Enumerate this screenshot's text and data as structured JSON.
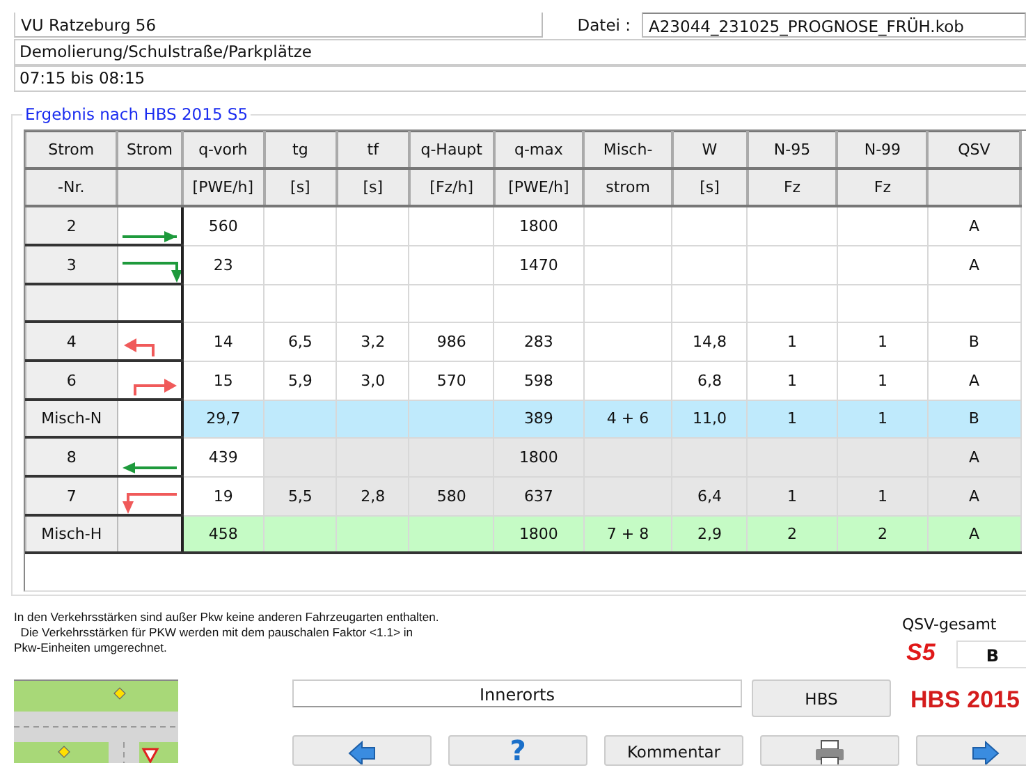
{
  "header": {
    "project": "VU Ratzeburg 56",
    "file_label": "Datei :",
    "file": "A23044_231025_PROGNOSE_FRÜH.kob",
    "location": "Demolierung/Schulstraße/Parkplätze",
    "period": "07:15 bis 08:15"
  },
  "result": {
    "title": "Ergebnis nach  HBS 2015 S5",
    "columns": [
      {
        "line1": "Strom",
        "line2": "-Nr."
      },
      {
        "line1": "Strom"
      },
      {
        "line1": "q-vorh",
        "line2": "[PWE/h]"
      },
      {
        "line1": "tg",
        "line2": "[s]"
      },
      {
        "line1": "tf",
        "line2": "[s]"
      },
      {
        "line1": "q-Haupt",
        "line2": "[Fz/h]"
      },
      {
        "line1": "q-max",
        "line2": "[PWE/h]"
      },
      {
        "line1": "Misch-",
        "line2": "strom"
      },
      {
        "line1": "W",
        "line2": "[s]"
      },
      {
        "line1": "N-95",
        "line2": "Fz"
      },
      {
        "line1": "N-99",
        "line2": "Fz"
      },
      {
        "line1": "QSV"
      }
    ],
    "rows": [
      {
        "kind": "plain",
        "strom_nr": "2",
        "arrow": {
          "kind": "east",
          "color": "#1e9a3c"
        },
        "cells": [
          "560",
          null,
          null,
          null,
          "1800",
          null,
          null,
          null,
          null,
          "A"
        ]
      },
      {
        "kind": "plain",
        "strom_nr": "3",
        "arrow": {
          "kind": "east-south",
          "color": "#1e9a3c"
        },
        "cells": [
          "23",
          null,
          null,
          null,
          "1470",
          null,
          null,
          null,
          null,
          "A"
        ]
      },
      {
        "kind": "plain"
      },
      {
        "kind": "plain",
        "strom_nr": "4",
        "arrow": {
          "kind": "north-west",
          "color": "#f05a5a"
        },
        "cells": [
          "14",
          "6,5",
          "3,2",
          "986",
          "283",
          null,
          "14,8",
          "1",
          "1",
          "B"
        ]
      },
      {
        "kind": "plain",
        "strom_nr": "6",
        "arrow": {
          "kind": "north-east",
          "color": "#f05a5a"
        },
        "cells": [
          "15",
          "5,9",
          "3,0",
          "570",
          "598",
          null,
          "6,8",
          "1",
          "1",
          "A"
        ]
      },
      {
        "kind": "mix-minor",
        "strom_nr": "Misch-N",
        "cells": [
          "29,7",
          null,
          null,
          null,
          "389",
          "4 + 6",
          "11,0",
          "1",
          "1",
          "B"
        ]
      },
      {
        "kind": "major",
        "strom_nr": "8",
        "arrow": {
          "kind": "west",
          "color": "#1e9a3c"
        },
        "cells": [
          "439",
          null,
          null,
          null,
          "1800",
          null,
          null,
          null,
          null,
          "A"
        ]
      },
      {
        "kind": "major",
        "strom_nr": "7",
        "arrow": {
          "kind": "west-south",
          "color": "#f05a5a"
        },
        "cells": [
          "19",
          "5,5",
          "2,8",
          "580",
          "637",
          null,
          "6,4",
          "1",
          "1",
          "A"
        ]
      },
      {
        "kind": "mix-major",
        "strom_nr": "Misch-H",
        "cells": [
          "458",
          null,
          null,
          null,
          "1800",
          "7 + 8",
          "2,9",
          "2",
          "2",
          "A"
        ]
      }
    ]
  },
  "notes": [
    "In den Verkehrsstärken sind außer Pkw keine anderen Fahrzeugarten enthalten.",
    "  Die Verkehrsstärken für PKW werden mit dem pauschalen Faktor <1.1> in",
    "Pkw-Einheiten umgerechnet."
  ],
  "total": {
    "label": "QSV-gesamt",
    "stage": "S5",
    "value": "B"
  },
  "area": "Innerorts",
  "method_button": "HBS",
  "method_logo": "HBS 2015",
  "buttons": [
    {
      "kind": "back"
    },
    {
      "kind": "help",
      "label": "?"
    },
    {
      "kind": "text",
      "label": "Kommentar"
    },
    {
      "kind": "print"
    },
    {
      "kind": "forward"
    }
  ]
}
